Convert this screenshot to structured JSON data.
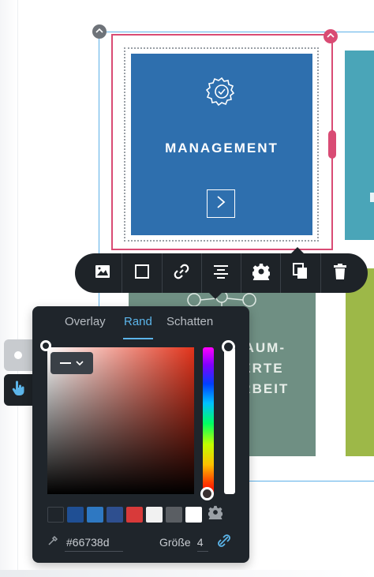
{
  "tiles": {
    "management": {
      "title": "MANAGEMENT",
      "color": "#2e6fae"
    },
    "sozial": {
      "title_lines": [
        "SOZIALRAUM-",
        "ORIENTIERTE",
        "SOZIALARBEIT"
      ],
      "color": "#6f8f83"
    },
    "teal_color": "#4aa5b8",
    "green_color": "#9db848"
  },
  "block_toolbar": {
    "buttons": [
      {
        "name": "image-button",
        "icon": "image-icon"
      },
      {
        "name": "border-button",
        "icon": "square-icon"
      },
      {
        "name": "link-button",
        "icon": "link-icon"
      },
      {
        "name": "align-button",
        "icon": "align-center-icon"
      },
      {
        "name": "settings-button",
        "icon": "gear-icon"
      },
      {
        "name": "duplicate-button",
        "icon": "copy-icon"
      },
      {
        "name": "delete-button",
        "icon": "trash-icon"
      }
    ]
  },
  "side_tabs": [
    {
      "name": "style-tab",
      "icon": "dot-icon"
    },
    {
      "name": "interaction-tab",
      "icon": "hand-pointer-icon"
    }
  ],
  "color_panel": {
    "tabs": [
      "Overlay",
      "Rand",
      "Schatten"
    ],
    "active_tab": "Rand",
    "border_style": "solid",
    "hex_label_value": "#66738d",
    "size_label": "Größe",
    "size_value": "4",
    "hue_color": "#e2331b",
    "swatches": [
      "#1f252b",
      "#1f4f94",
      "#2e78c2",
      "#2e4f8f",
      "#d83a3a",
      "#f1f1f1",
      "#5a5e63",
      "#ffffff"
    ]
  }
}
